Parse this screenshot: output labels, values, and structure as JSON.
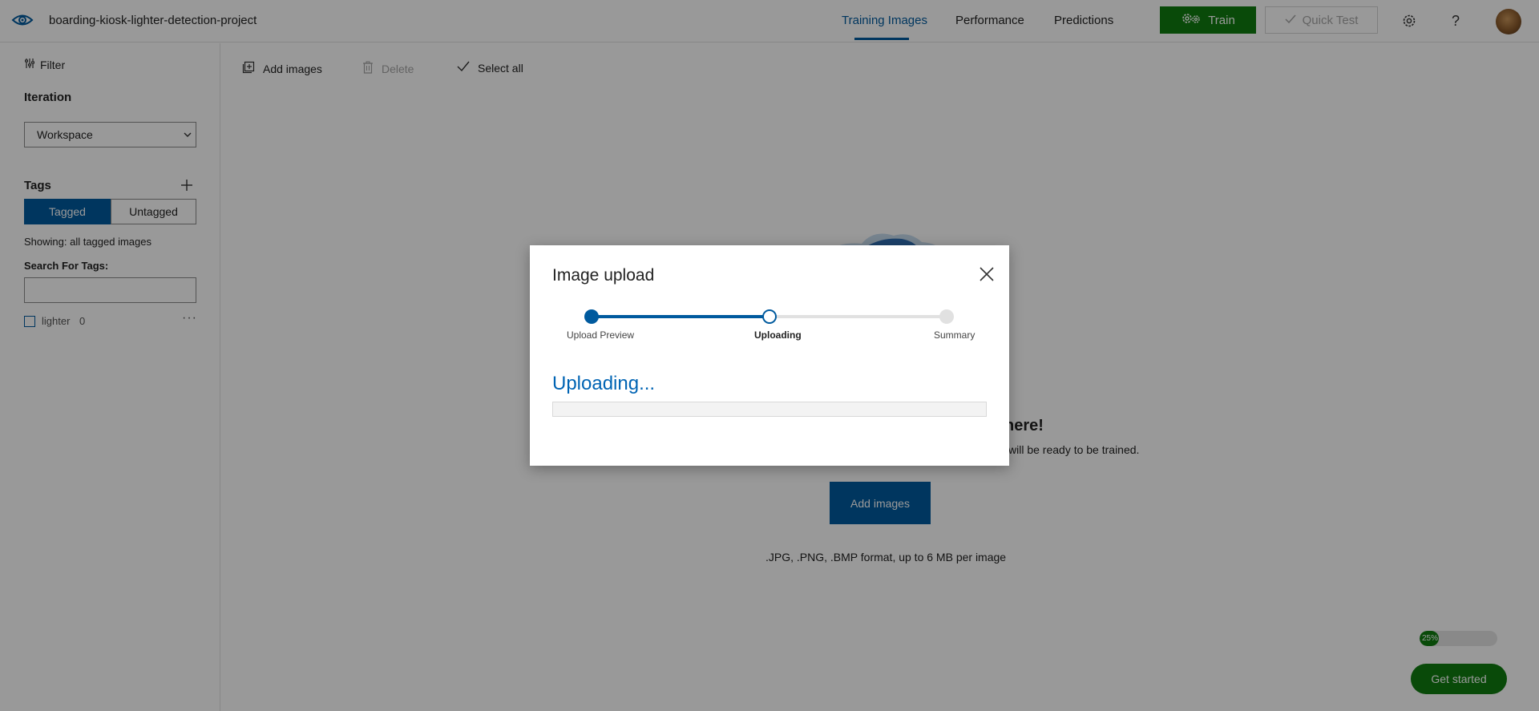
{
  "header": {
    "project_title": "boarding-kiosk-lighter-detection-project",
    "tabs": [
      {
        "label": "Training Images",
        "active": true
      },
      {
        "label": "Performance",
        "active": false
      },
      {
        "label": "Predictions",
        "active": false
      }
    ],
    "train_label": "Train",
    "quick_test_label": "Quick Test"
  },
  "sidebar": {
    "filter_label": "Filter",
    "iteration_label": "Iteration",
    "iteration_value": "Workspace",
    "tags_label": "Tags",
    "segments": {
      "tagged": "Tagged",
      "untagged": "Untagged"
    },
    "showing": "Showing: all tagged images",
    "search_label": "Search For Tags:",
    "search_value": "",
    "tags": [
      {
        "name": "lighter",
        "count": "0"
      }
    ]
  },
  "toolbar": {
    "add_images": "Add images",
    "delete": "Delete",
    "select_all": "Select all"
  },
  "main": {
    "empty_title_partial": "here!",
    "empty_subtitle_partial": "will be ready to be trained.",
    "add_images_button": "Add images",
    "formats_note": ".JPG, .PNG, .BMP format, up to 6 MB per image"
  },
  "onboarding": {
    "progress_percent": 25,
    "progress_label": "25%",
    "get_started_label": "Get started"
  },
  "dialog": {
    "title": "Image upload",
    "steps": [
      {
        "label": "Upload Preview",
        "state": "done"
      },
      {
        "label": "Uploading",
        "state": "current"
      },
      {
        "label": "Summary",
        "state": "pending"
      }
    ],
    "status_text": "Uploading...",
    "upload_progress": 0
  },
  "colors": {
    "brand_blue": "#005a9e",
    "train_green": "#107c10",
    "uploading_text": "#0064b4"
  }
}
